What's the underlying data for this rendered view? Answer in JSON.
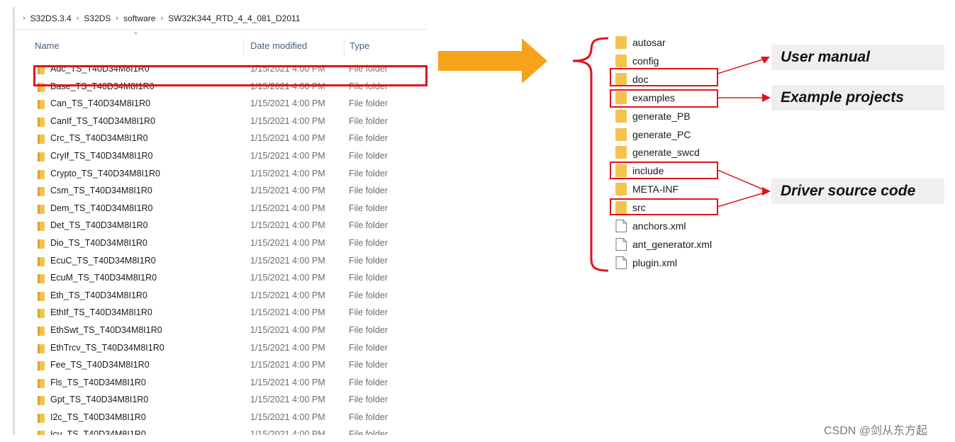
{
  "breadcrumb": [
    "S32DS.3.4",
    "S32DS",
    "software",
    "SW32K344_RTD_4_4_081_D2011"
  ],
  "columns": {
    "name": "Name",
    "date": "Date modified",
    "type": "Type"
  },
  "rows": [
    {
      "name": "Adc_TS_T40D34M8I1R0",
      "date": "1/15/2021 4:00 PM",
      "type": "File folder"
    },
    {
      "name": "Base_TS_T40D34M8I1R0",
      "date": "1/15/2021 4:00 PM",
      "type": "File folder"
    },
    {
      "name": "Can_TS_T40D34M8I1R0",
      "date": "1/15/2021 4:00 PM",
      "type": "File folder"
    },
    {
      "name": "CanIf_TS_T40D34M8I1R0",
      "date": "1/15/2021 4:00 PM",
      "type": "File folder"
    },
    {
      "name": "Crc_TS_T40D34M8I1R0",
      "date": "1/15/2021 4:00 PM",
      "type": "File folder"
    },
    {
      "name": "CryIf_TS_T40D34M8I1R0",
      "date": "1/15/2021 4:00 PM",
      "type": "File folder"
    },
    {
      "name": "Crypto_TS_T40D34M8I1R0",
      "date": "1/15/2021 4:00 PM",
      "type": "File folder"
    },
    {
      "name": "Csm_TS_T40D34M8I1R0",
      "date": "1/15/2021 4:00 PM",
      "type": "File folder"
    },
    {
      "name": "Dem_TS_T40D34M8I1R0",
      "date": "1/15/2021 4:00 PM",
      "type": "File folder"
    },
    {
      "name": "Det_TS_T40D34M8I1R0",
      "date": "1/15/2021 4:00 PM",
      "type": "File folder"
    },
    {
      "name": "Dio_TS_T40D34M8I1R0",
      "date": "1/15/2021 4:00 PM",
      "type": "File folder"
    },
    {
      "name": "EcuC_TS_T40D34M8I1R0",
      "date": "1/15/2021 4:00 PM",
      "type": "File folder"
    },
    {
      "name": "EcuM_TS_T40D34M8I1R0",
      "date": "1/15/2021 4:00 PM",
      "type": "File folder"
    },
    {
      "name": "Eth_TS_T40D34M8I1R0",
      "date": "1/15/2021 4:00 PM",
      "type": "File folder"
    },
    {
      "name": "EthIf_TS_T40D34M8I1R0",
      "date": "1/15/2021 4:00 PM",
      "type": "File folder"
    },
    {
      "name": "EthSwt_TS_T40D34M8I1R0",
      "date": "1/15/2021 4:00 PM",
      "type": "File folder"
    },
    {
      "name": "EthTrcv_TS_T40D34M8I1R0",
      "date": "1/15/2021 4:00 PM",
      "type": "File folder"
    },
    {
      "name": "Fee_TS_T40D34M8I1R0",
      "date": "1/15/2021 4:00 PM",
      "type": "File folder"
    },
    {
      "name": "Fls_TS_T40D34M8I1R0",
      "date": "1/15/2021 4:00 PM",
      "type": "File folder"
    },
    {
      "name": "Gpt_TS_T40D34M8I1R0",
      "date": "1/15/2021 4:00 PM",
      "type": "File folder"
    },
    {
      "name": "I2c_TS_T40D34M8I1R0",
      "date": "1/15/2021 4:00 PM",
      "type": "File folder"
    },
    {
      "name": "Icu_TS_T40D34M8I1R0",
      "date": "1/15/2021 4:00 PM",
      "type": "File folder"
    }
  ],
  "tree": [
    {
      "name": "autosar",
      "kind": "folder"
    },
    {
      "name": "config",
      "kind": "folder"
    },
    {
      "name": "doc",
      "kind": "folder"
    },
    {
      "name": "examples",
      "kind": "folder"
    },
    {
      "name": "generate_PB",
      "kind": "folder"
    },
    {
      "name": "generate_PC",
      "kind": "folder"
    },
    {
      "name": "generate_swcd",
      "kind": "folder"
    },
    {
      "name": "include",
      "kind": "folder"
    },
    {
      "name": "META-INF",
      "kind": "folder"
    },
    {
      "name": "src",
      "kind": "folder"
    },
    {
      "name": "anchors.xml",
      "kind": "file"
    },
    {
      "name": "ant_generator.xml",
      "kind": "file"
    },
    {
      "name": "plugin.xml",
      "kind": "file"
    }
  ],
  "callouts": {
    "user_manual": "User manual",
    "example_projects": "Example projects",
    "driver_source": "Driver source code"
  },
  "watermark": "CSDN @剑从东方起",
  "colors": {
    "highlight": "#e0131d",
    "arrow": "#f7a21b",
    "folder": "#f4c34f",
    "callout_bg": "#efefef"
  }
}
